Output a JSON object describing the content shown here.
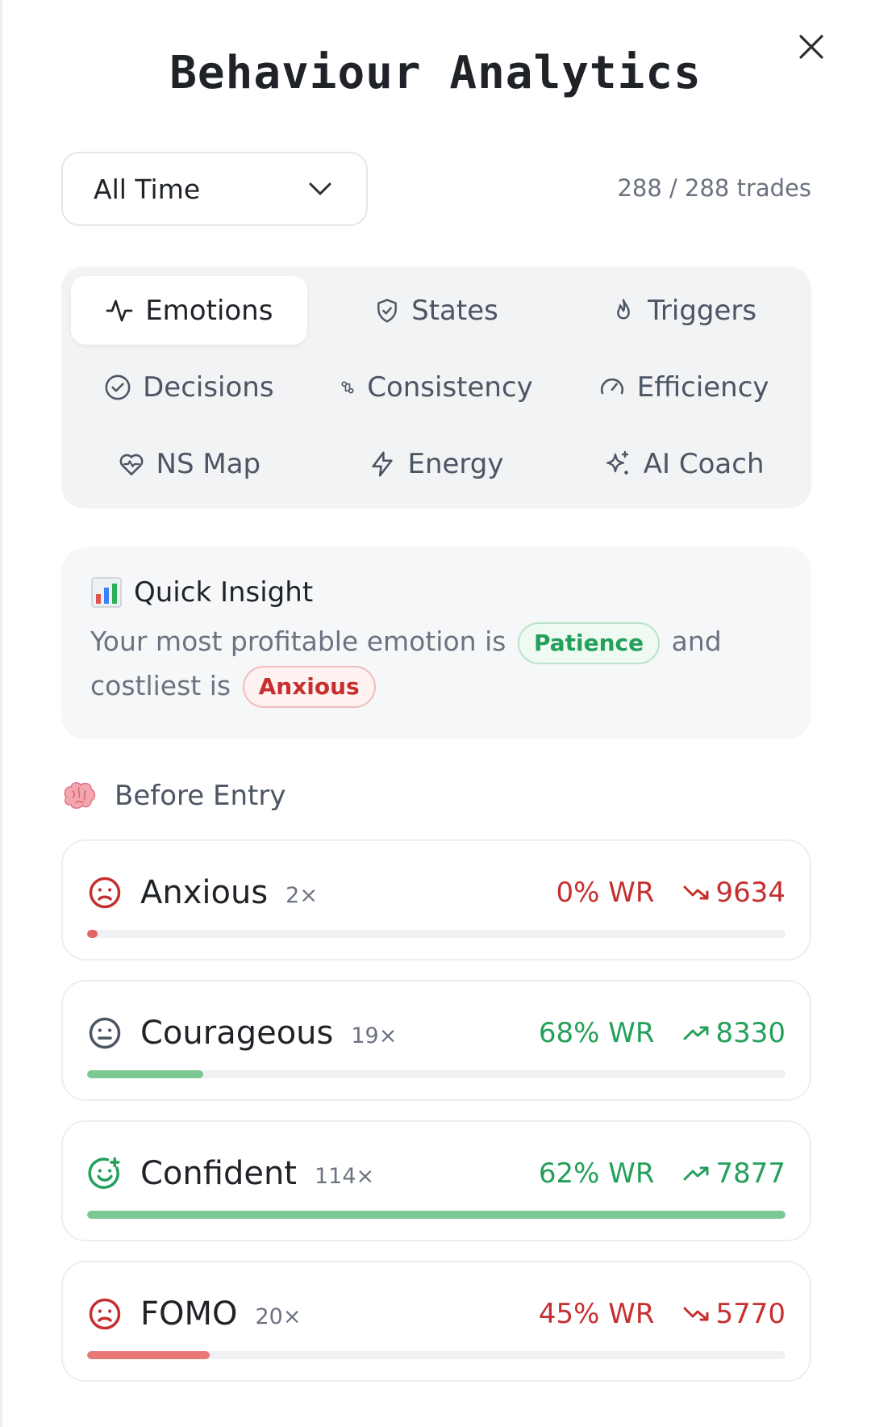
{
  "header": {
    "title": "Behaviour Analytics"
  },
  "filter": {
    "range_label": "All Time",
    "trade_count": "288 / 288 trades"
  },
  "tabs": [
    {
      "label": "Emotions",
      "icon": "pulse-icon",
      "active": true
    },
    {
      "label": "States",
      "icon": "shield-icon",
      "active": false
    },
    {
      "label": "Triggers",
      "icon": "flame-icon",
      "active": false
    },
    {
      "label": "Decisions",
      "icon": "check-circle-icon",
      "active": false
    },
    {
      "label": "Consistency",
      "icon": "dots-icon",
      "active": false
    },
    {
      "label": "Efficiency",
      "icon": "gauge-icon",
      "active": false
    },
    {
      "label": "NS Map",
      "icon": "heart-pulse-icon",
      "active": false
    },
    {
      "label": "Energy",
      "icon": "bolt-icon",
      "active": false
    },
    {
      "label": "AI Coach",
      "icon": "sparkles-icon",
      "active": false
    }
  ],
  "insight": {
    "title": "Quick Insight",
    "text_1": "Your most profitable emotion is",
    "best": "Patience",
    "text_2": "and",
    "text_3": "costliest is",
    "worst": "Anxious"
  },
  "section": {
    "title": "Before Entry"
  },
  "emotions": [
    {
      "name": "Anxious",
      "count": "2×",
      "wr": "0% WR",
      "pnl": "9634",
      "trend": "down",
      "face": "sad",
      "fill": 0.015,
      "color": "#e06666"
    },
    {
      "name": "Courageous",
      "count": "19×",
      "wr": "68% WR",
      "pnl": "8330",
      "trend": "up",
      "face": "neutral",
      "fill": 0.166,
      "color": "#7cc895"
    },
    {
      "name": "Confident",
      "count": "114×",
      "wr": "62% WR",
      "pnl": "7877",
      "trend": "up",
      "face": "happy",
      "fill": 1.0,
      "color": "#7cc895"
    },
    {
      "name": "FOMO",
      "count": "20×",
      "wr": "45% WR",
      "pnl": "5770",
      "trend": "down",
      "face": "sad",
      "fill": 0.175,
      "color": "#e97878"
    }
  ],
  "colors": {
    "positive": "#23a05a",
    "negative": "#c62f2f"
  }
}
